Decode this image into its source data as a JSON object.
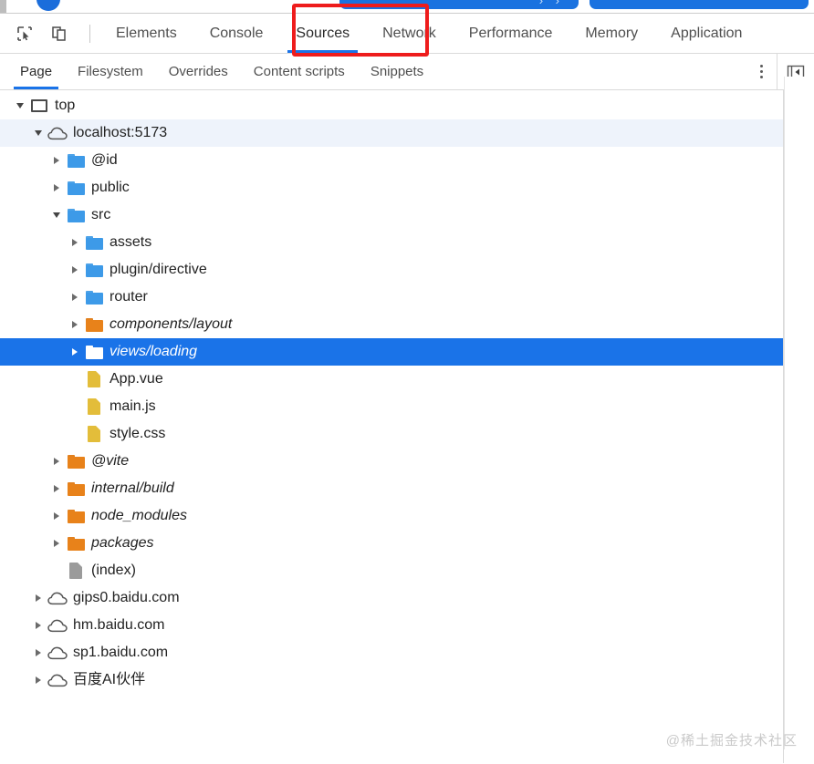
{
  "page_strip": {
    "button_primary_glyph": "› ›",
    "note": "partially visible page content above devtools"
  },
  "devtools": {
    "toolbar": {
      "inspect_icon": "inspect-element-icon",
      "device_icon": "device-toolbar-icon",
      "tabs": [
        {
          "label": "Elements",
          "active": false
        },
        {
          "label": "Console",
          "active": false
        },
        {
          "label": "Sources",
          "active": true
        },
        {
          "label": "Network",
          "active": false
        },
        {
          "label": "Performance",
          "active": false
        },
        {
          "label": "Memory",
          "active": false
        },
        {
          "label": "Application",
          "active": false
        }
      ]
    },
    "subtabs": {
      "items": [
        {
          "label": "Page",
          "active": true
        },
        {
          "label": "Filesystem",
          "active": false
        },
        {
          "label": "Overrides",
          "active": false
        },
        {
          "label": "Content scripts",
          "active": false
        },
        {
          "label": "Snippets",
          "active": false
        }
      ],
      "more_options_icon": "kebab-menu-icon",
      "collapse_icon": "collapse-sidebar-icon"
    },
    "navigator_tree": [
      {
        "label": "top",
        "indent": 0,
        "arrow": "down",
        "icon": "frame",
        "italic": false,
        "state": "none"
      },
      {
        "label": "localhost:5173",
        "indent": 1,
        "arrow": "down",
        "icon": "cloud",
        "italic": false,
        "state": "soft"
      },
      {
        "label": "@id",
        "indent": 2,
        "arrow": "right",
        "icon": "folder-blue",
        "italic": false,
        "state": "none"
      },
      {
        "label": "public",
        "indent": 2,
        "arrow": "right",
        "icon": "folder-blue",
        "italic": false,
        "state": "none"
      },
      {
        "label": "src",
        "indent": 2,
        "arrow": "down",
        "icon": "folder-blue",
        "italic": false,
        "state": "none"
      },
      {
        "label": "assets",
        "indent": 3,
        "arrow": "right",
        "icon": "folder-blue",
        "italic": false,
        "state": "none"
      },
      {
        "label": "plugin/directive",
        "indent": 3,
        "arrow": "right",
        "icon": "folder-blue",
        "italic": false,
        "state": "none"
      },
      {
        "label": "router",
        "indent": 3,
        "arrow": "right",
        "icon": "folder-blue",
        "italic": false,
        "state": "none"
      },
      {
        "label": "components/layout",
        "indent": 3,
        "arrow": "right",
        "icon": "folder-orange",
        "italic": true,
        "state": "none"
      },
      {
        "label": "views/loading",
        "indent": 3,
        "arrow": "right",
        "icon": "folder-white",
        "italic": true,
        "state": "selected"
      },
      {
        "label": "App.vue",
        "indent": 3,
        "arrow": "none",
        "icon": "doc-yellow",
        "italic": false,
        "state": "none"
      },
      {
        "label": "main.js",
        "indent": 3,
        "arrow": "none",
        "icon": "doc-yellow",
        "italic": false,
        "state": "none"
      },
      {
        "label": "style.css",
        "indent": 3,
        "arrow": "none",
        "icon": "doc-yellow",
        "italic": false,
        "state": "none"
      },
      {
        "label": "@vite",
        "indent": 2,
        "arrow": "right",
        "icon": "folder-orange",
        "italic": true,
        "state": "none"
      },
      {
        "label": "internal/build",
        "indent": 2,
        "arrow": "right",
        "icon": "folder-orange",
        "italic": true,
        "state": "none"
      },
      {
        "label": "node_modules",
        "indent": 2,
        "arrow": "right",
        "icon": "folder-orange",
        "italic": true,
        "state": "none"
      },
      {
        "label": "packages",
        "indent": 2,
        "arrow": "right",
        "icon": "folder-orange",
        "italic": true,
        "state": "none"
      },
      {
        "label": "(index)",
        "indent": 2,
        "arrow": "none",
        "icon": "doc-gray",
        "italic": false,
        "state": "none"
      },
      {
        "label": "gips0.baidu.com",
        "indent": 1,
        "arrow": "right",
        "icon": "cloud",
        "italic": false,
        "state": "none"
      },
      {
        "label": "hm.baidu.com",
        "indent": 1,
        "arrow": "right",
        "icon": "cloud",
        "italic": false,
        "state": "none"
      },
      {
        "label": "sp1.baidu.com",
        "indent": 1,
        "arrow": "right",
        "icon": "cloud",
        "italic": false,
        "state": "none"
      },
      {
        "label": "百度AI伙伴",
        "indent": 1,
        "arrow": "right",
        "icon": "cloud",
        "italic": false,
        "state": "none"
      }
    ]
  },
  "annotation": {
    "highlight_target": "Sources",
    "color": "#ee1c1c"
  },
  "watermark": {
    "text": "@稀土掘金技术社区"
  },
  "colors": {
    "accent": "#1a73e8",
    "selection_bg": "#1a73e8",
    "soft_highlight": "#eef3fb",
    "folder_blue": "#3d9ae8",
    "folder_orange": "#e8821a",
    "file_yellow": "#e3bd3a",
    "file_gray": "#9b9b9b",
    "annotation_red": "#ee1c1c"
  }
}
